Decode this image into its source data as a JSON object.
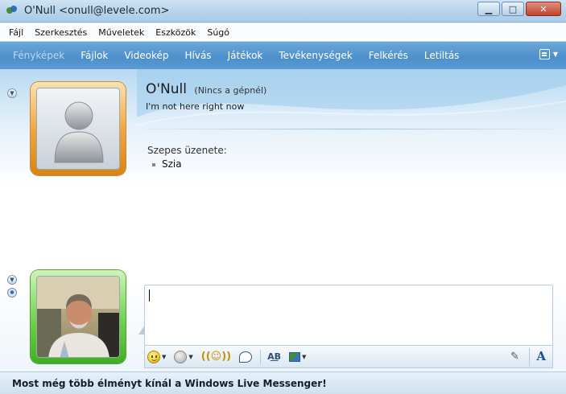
{
  "window": {
    "title": "O'Null <onull@levele.com>",
    "controls": {
      "minimize": "▁",
      "maximize": "□",
      "close": "✕"
    }
  },
  "menubar": {
    "items": [
      {
        "label": "Fájl"
      },
      {
        "label": "Szerkesztés"
      },
      {
        "label": "Műveletek"
      },
      {
        "label": "Eszközök"
      },
      {
        "label": "Súgó"
      }
    ]
  },
  "toolbar": {
    "items": [
      {
        "label": "Fényképek",
        "enabled": false
      },
      {
        "label": "Fájlok",
        "enabled": true
      },
      {
        "label": "Videokép",
        "enabled": true
      },
      {
        "label": "Hívás",
        "enabled": true
      },
      {
        "label": "Játékok",
        "enabled": true
      },
      {
        "label": "Tevékenységek",
        "enabled": true
      },
      {
        "label": "Felkérés",
        "enabled": true
      },
      {
        "label": "Letiltás",
        "enabled": true
      }
    ]
  },
  "contact": {
    "name": "O'Null",
    "status": "(Nincs a gépnél)",
    "personal_message": "I'm not here right now"
  },
  "notes": {
    "label": "Szepes üzenete:",
    "items": [
      "Szia"
    ]
  },
  "compose": {
    "value": ""
  },
  "banner": {
    "text": "Most még több élményt kínál a Windows Live Messenger!"
  },
  "colors": {
    "toolbar": "#4d8fcb",
    "contact_frame": "#f0a23b",
    "self_frame": "#6cd34a"
  }
}
